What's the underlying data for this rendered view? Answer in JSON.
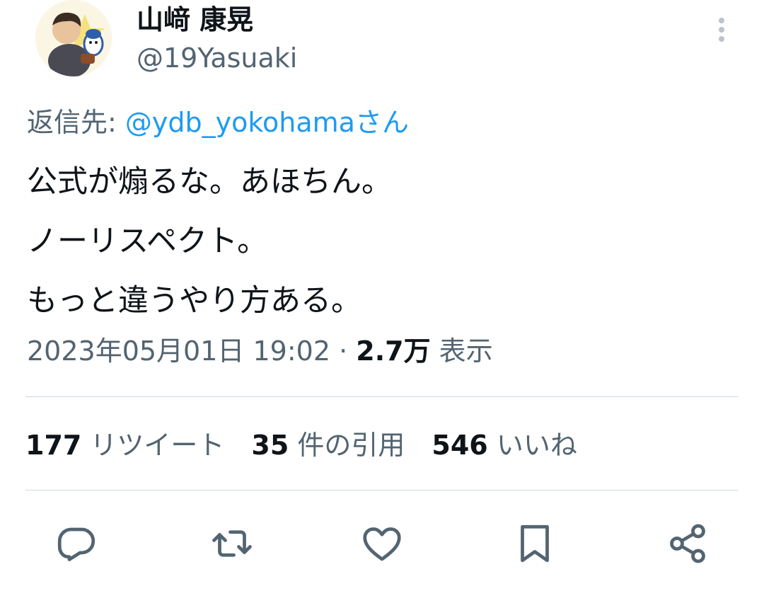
{
  "author": {
    "display_name": "山﨑 康晃",
    "handle": "@19Yasuaki",
    "avatar_icon": "avatar-illustration-icon"
  },
  "reply": {
    "prefix": "返信先: ",
    "mention": "@ydb_yokohama",
    "suffix": "さん"
  },
  "tweet": {
    "lines": [
      "公式が煽るな。あほちん。",
      "ノーリスペクト。",
      "もっと違うやり方ある。"
    ]
  },
  "meta": {
    "timestamp": "2023年05月01日 19:02",
    "separator": " · ",
    "views_count": "2.7万",
    "views_label": " 表示"
  },
  "stats": {
    "retweets_count": "177",
    "retweets_label": " リツイート",
    "quotes_count": "35",
    "quotes_label": " 件の引用",
    "likes_count": "546",
    "likes_label": " いいね"
  },
  "actions": {
    "icons": [
      "reply-icon",
      "retweet-icon",
      "like-icon",
      "bookmark-icon",
      "share-icon"
    ]
  },
  "colors": {
    "text_primary": "#0f1419",
    "text_secondary": "#536471",
    "link": "#1d9bf0",
    "divider": "#cfd9de"
  }
}
